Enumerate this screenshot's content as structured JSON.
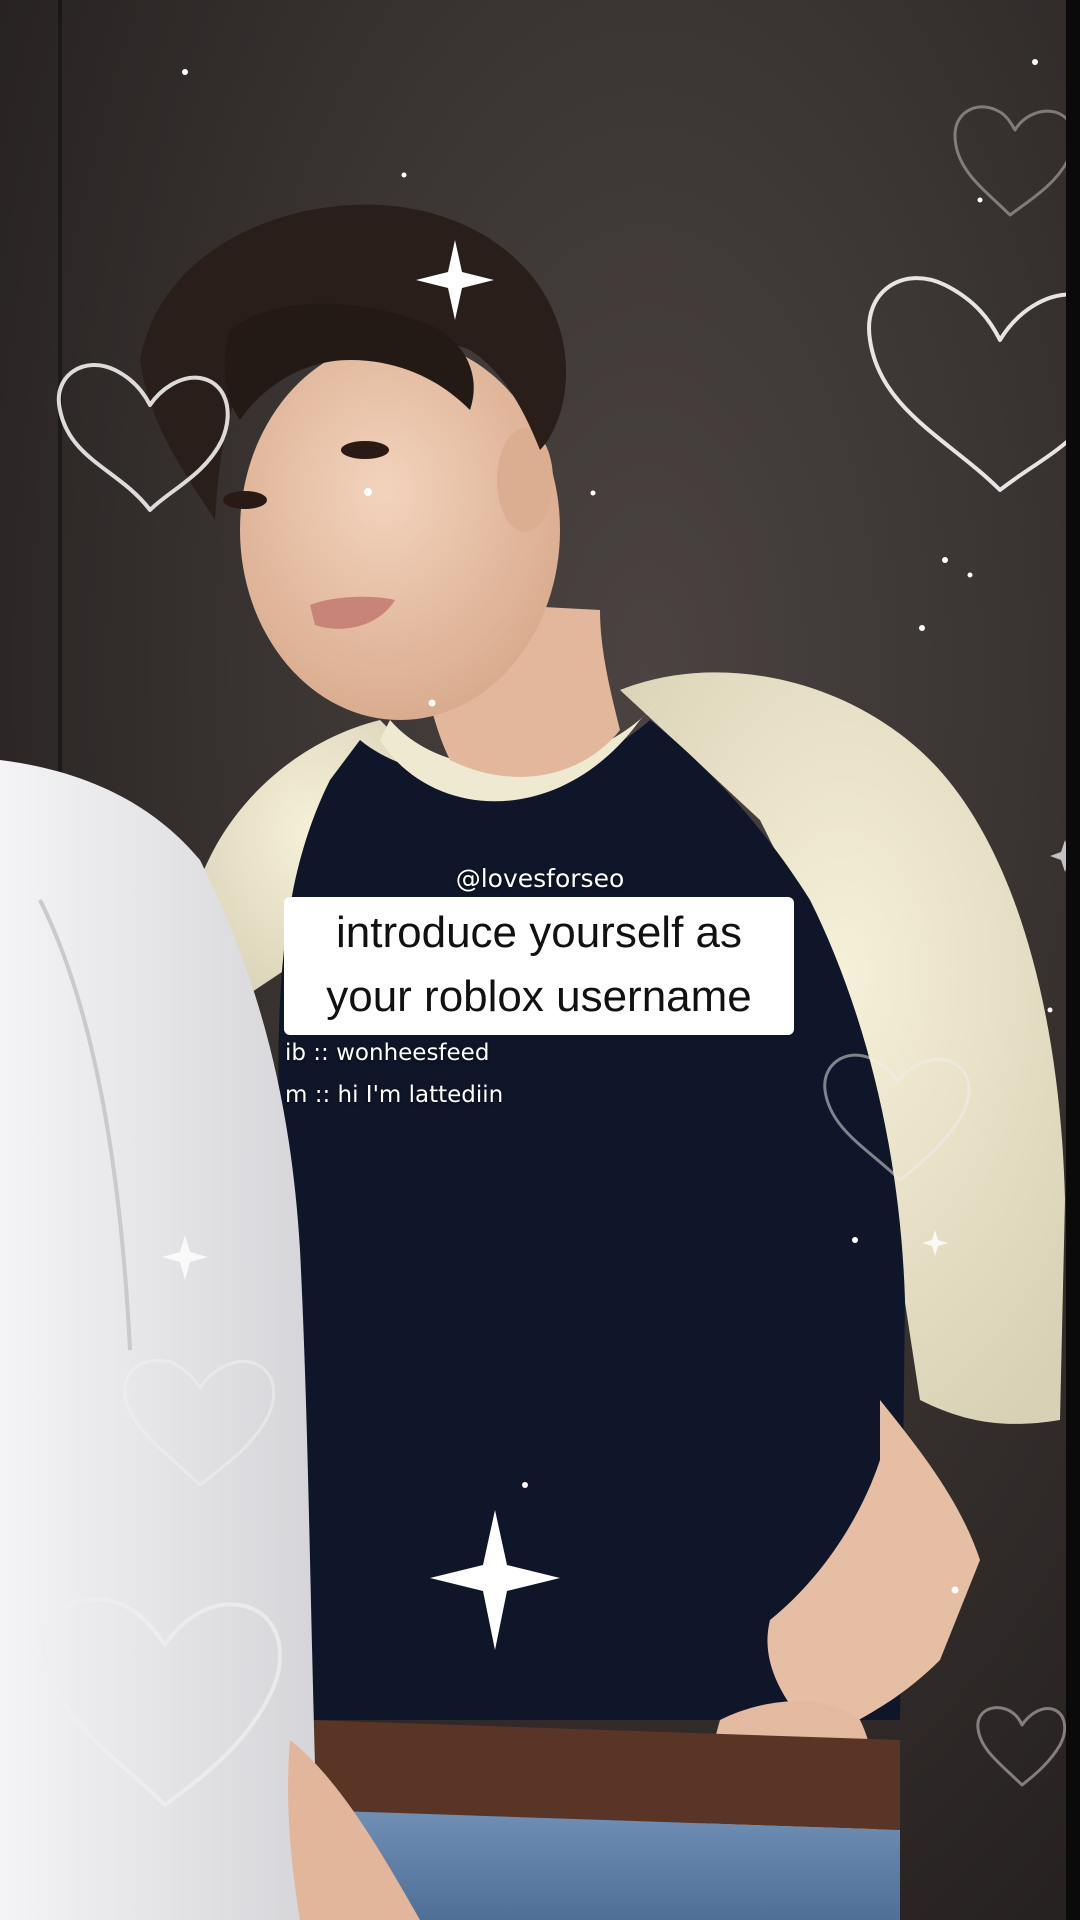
{
  "overlay": {
    "handle": "@lovesforseo",
    "title_line_1": "introduce yourself as",
    "title_line_2": "your roblox username",
    "sub_line_1": "ib :: wonheesfeed",
    "sub_line_2": "m :: hi I'm lattediin"
  },
  "scene": {
    "heart_outline_color": "#f2eeee",
    "sparkle_color": "#ffffff",
    "shirt_body_color": "#0f1522",
    "shirt_sleeve_color": "#efe9d2",
    "skin_color": "#e9c2a9",
    "hair_color": "#2a1e1a",
    "wall_color": "#3a3432"
  }
}
